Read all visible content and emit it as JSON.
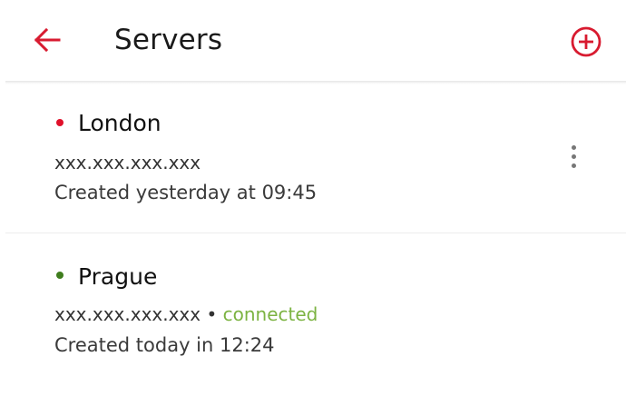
{
  "header": {
    "title": "Servers",
    "back_icon": "arrow-left-icon",
    "add_icon": "plus-circle-icon"
  },
  "colors": {
    "accent": "#d81b30",
    "status_offline": "#e0102a",
    "status_online": "#3f7d1e",
    "connected_text": "#7cb342"
  },
  "servers": [
    {
      "name": "London",
      "ip": "xxx.xxx.xxx.xxx",
      "status": "",
      "created": "Created yesterday at 09:45",
      "menu_icon": "more-vertical-icon"
    },
    {
      "name": "Prague",
      "ip": "xxx.xxx.xxx.xxx",
      "separator": "•",
      "status": "connected",
      "created": "Created today in 12:24"
    }
  ]
}
